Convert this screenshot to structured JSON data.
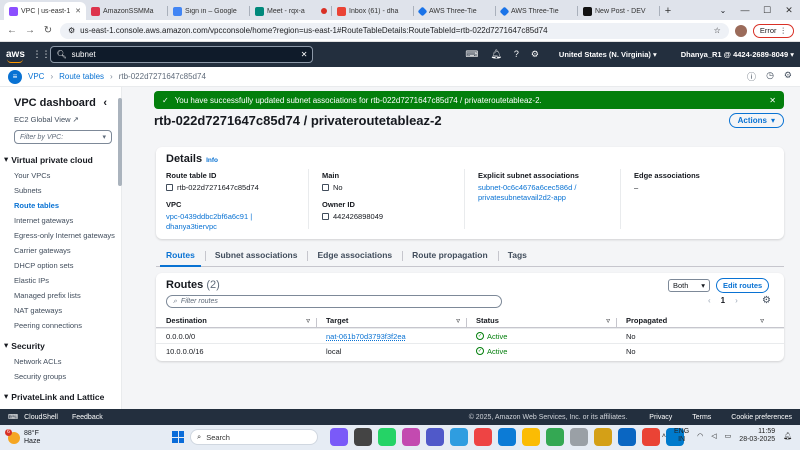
{
  "browser": {
    "tabs": [
      {
        "title": "VPC | us-east-1",
        "favicon_color": "#8c4fff",
        "active": true
      },
      {
        "title": "AmazonSSMMa",
        "favicon_color": "#dd344c"
      },
      {
        "title": "Sign in – Google",
        "favicon_color": "#4285f4"
      },
      {
        "title": "Meet - rqx-a",
        "favicon_color": "#00897b"
      },
      {
        "title": "Inbox (61) - dha",
        "favicon_color": "#ea4335"
      },
      {
        "title": "AWS Three-Tie",
        "favicon_color": "#1a73e8"
      },
      {
        "title": "AWS Three-Tie",
        "favicon_color": "#1a73e8"
      },
      {
        "title": "New Post - DEV",
        "favicon_color": "#111111"
      }
    ],
    "new_tab": "+",
    "url": "us-east-1.console.aws.amazon.com/vpcconsole/home?region=us-east-1#RouteTableDetails:RouteTableId=rtb-022d7271647c85d74",
    "error_label": "Error"
  },
  "aws_nav": {
    "logo": "aws",
    "search_value": "subnet",
    "region": "United States (N. Virginia)",
    "account": "Dhanya_R1 @ 4424-2689-8049"
  },
  "breadcrumb": {
    "items": [
      "VPC",
      "Route tables",
      "rtb-022d7271647c85d74"
    ]
  },
  "sidebar": {
    "title": "VPC dashboard",
    "global_view": "EC2 Global View",
    "filter_placeholder": "Filter by VPC:",
    "sections": [
      {
        "title": "Virtual private cloud",
        "items": [
          "Your VPCs",
          "Subnets",
          "Route tables",
          "Internet gateways",
          "Egress-only Internet gateways",
          "Carrier gateways",
          "DHCP option sets",
          "Elastic IPs",
          "Managed prefix lists",
          "NAT gateways",
          "Peering connections"
        ]
      },
      {
        "title": "Security",
        "items": [
          "Network ACLs",
          "Security groups"
        ]
      },
      {
        "title": "PrivateLink and Lattice",
        "items": []
      }
    ],
    "active_item": "Route tables"
  },
  "flash": {
    "message": "You have successfully updated subnet associations for rtb-022d7271647c85d74 / privateroutetableaz-2."
  },
  "page": {
    "title": "rtb-022d7271647c85d74 / privateroutetableaz-2",
    "actions_label": "Actions"
  },
  "details": {
    "title": "Details",
    "info": "Info",
    "route_table_id_label": "Route table ID",
    "route_table_id": "rtb-022d7271647c85d74",
    "main_label": "Main",
    "main_value": "No",
    "explicit_label": "Explicit subnet associations",
    "explicit_value_1": "subnet-0c6c4676a6cec586d /",
    "explicit_value_2": "privatesubnetavail2d2-app",
    "edge_label": "Edge associations",
    "edge_value": "–",
    "vpc_label": "VPC",
    "vpc_value_1": "vpc-0439ddbc2bf6a6c91 |",
    "vpc_value_2": "dhanya3tiervpc",
    "owner_label": "Owner ID",
    "owner_value": "442426898049"
  },
  "tabs": [
    "Routes",
    "Subnet associations",
    "Edge associations",
    "Route propagation",
    "Tags"
  ],
  "routes": {
    "title": "Routes",
    "count": "(2)",
    "filter_select": "Both",
    "edit_label": "Edit routes",
    "filter_placeholder": "Filter routes",
    "page": "1",
    "columns": [
      "Destination",
      "Target",
      "Status",
      "Propagated"
    ],
    "rows": [
      {
        "destination": "0.0.0.0/0",
        "target": "nat-061b70d3793f3f2ea",
        "target_link": true,
        "status": "Active",
        "propagated": "No"
      },
      {
        "destination": "10.0.0.0/16",
        "target": "local",
        "target_link": false,
        "status": "Active",
        "propagated": "No"
      }
    ]
  },
  "footer": {
    "cloudshell": "CloudShell",
    "feedback": "Feedback",
    "copyright": "© 2025, Amazon Web Services, Inc. or its affiliates.",
    "privacy": "Privacy",
    "terms": "Terms",
    "cookies": "Cookie preferences"
  },
  "taskbar": {
    "weather_temp": "88°F",
    "weather_desc": "Haze",
    "weather_badge": "6",
    "search_label": "Search",
    "lang_1": "ENG",
    "lang_2": "IN",
    "time": "11:59",
    "date": "28-03-2025"
  },
  "colors": {
    "aws_nav": "#232f3e",
    "link": "#0972d3",
    "success": "#037f0c"
  }
}
